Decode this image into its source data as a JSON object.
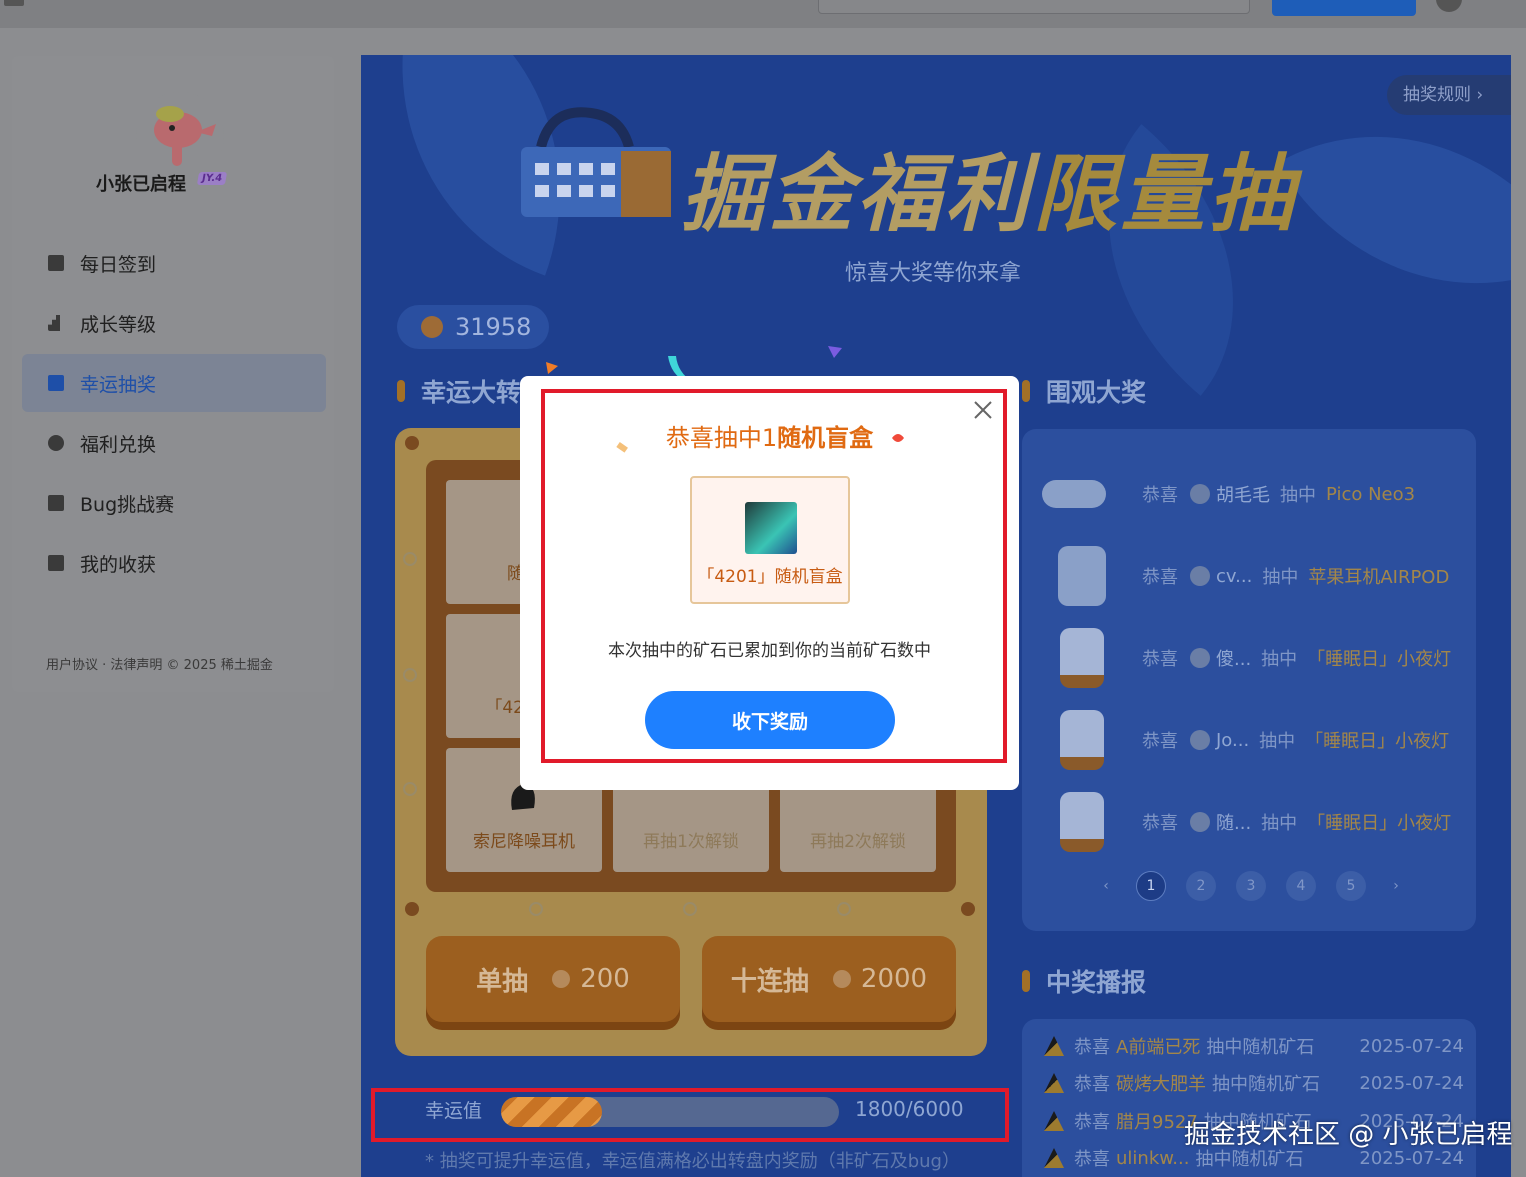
{
  "sidebar": {
    "username": "小张已启程",
    "level": "JY.4",
    "items": [
      {
        "label": "每日签到",
        "icon": "calendar-check-icon"
      },
      {
        "label": "成长等级",
        "icon": "bar-chart-icon"
      },
      {
        "label": "幸运抽奖",
        "icon": "gift-icon",
        "active": true
      },
      {
        "label": "福利兑换",
        "icon": "coins-stack-icon"
      },
      {
        "label": "Bug挑战赛",
        "icon": "bug-icon"
      },
      {
        "label": "我的收获",
        "icon": "bag-icon"
      }
    ],
    "footer": "用户协议 · 法律声明 © 2025 稀土掘金"
  },
  "banner": {
    "title_a": "掘金福利",
    "title_b": "限量抽",
    "subtitle": "惊喜大奖等你来拿",
    "rules_label": "抽奖规则 ›"
  },
  "balance": "31958",
  "wheel": {
    "section_title": "幸运大转",
    "cells": [
      {
        "label": "随机",
        "state": "normal"
      },
      {
        "label": "「4201」",
        "state": "normal"
      },
      {
        "label": "索尼降噪耳机",
        "state": "normal"
      },
      {
        "label": "再抽1次解锁",
        "state": "locked"
      },
      {
        "label": "再抽2次解锁",
        "state": "locked"
      }
    ],
    "single": {
      "label": "单抽",
      "cost": "200"
    },
    "ten": {
      "label": "十连抽",
      "cost": "2000"
    }
  },
  "luck": {
    "label": "幸运值",
    "current": "1800",
    "max": "/6000",
    "progress": 0.3,
    "note": "* 抽奖可提升幸运值，幸运值满格必出转盘内奖励（非矿石及bug）"
  },
  "watchers": {
    "title": "围观大奖",
    "congrats": "恭喜",
    "draw_word": "抽中",
    "rows": [
      {
        "user": "胡毛毛",
        "prize": "Pico Neo3"
      },
      {
        "user": "cv...",
        "prize": "苹果耳机AIRPOD"
      },
      {
        "user": "傻...",
        "prize": "「睡眠日」小夜灯"
      },
      {
        "user": "Jo...",
        "prize": "「睡眠日」小夜灯"
      },
      {
        "user": "随...",
        "prize": "「睡眠日」小夜灯"
      }
    ],
    "pages": [
      "‹",
      "1",
      "2",
      "3",
      "4",
      "5",
      "›"
    ],
    "current_page": "1"
  },
  "broadcast": {
    "title": "中奖播报",
    "rows": [
      {
        "congrats": "恭喜",
        "user": "A前端已死",
        "text": "抽中随机矿石",
        "date": "2025-07-24"
      },
      {
        "congrats": "恭喜",
        "user": "碳烤大肥羊",
        "text": "抽中随机矿石",
        "date": "2025-07-24"
      },
      {
        "congrats": "恭喜",
        "user": "腊月9527",
        "text": "抽中随机矿石",
        "date": "2025-07-24"
      },
      {
        "congrats": "恭喜",
        "user": "ulinkw...",
        "text": "抽中随机矿石",
        "date": "2025-07-24"
      }
    ]
  },
  "modal": {
    "title_prefix": "恭喜抽中1",
    "title_prize": "随机盲盒",
    "prize_label": "「4201」随机盲盒",
    "description": "本次抽中的矿石已累加到你的当前矿石数中",
    "accept_label": "收下奖励"
  },
  "watermark": "掘金技术社区 @ 小张已启程",
  "colors": {
    "accent": "#1e80ff",
    "highlight_box": "#e11a2a",
    "title_orange": "#e06a12"
  }
}
